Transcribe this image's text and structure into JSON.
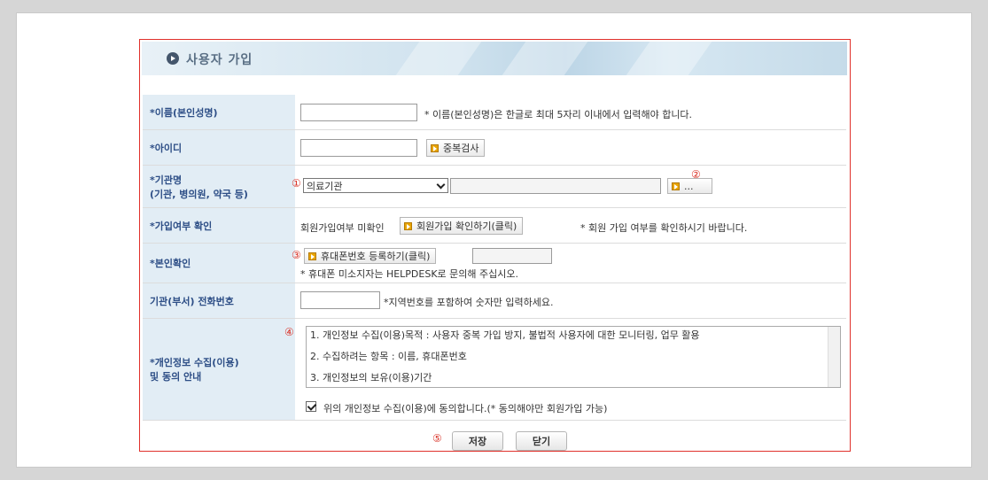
{
  "header": {
    "title": "사용자 가입"
  },
  "fields": {
    "name": {
      "label": "*이름(본인성명)",
      "value": "",
      "hint": "* 이름(본인성명)은 한글로 최대 5자리 이내에서 입력해야 합니다."
    },
    "id": {
      "label": "*아이디",
      "value": "",
      "check_button": "중복검사"
    },
    "org": {
      "label_line1": "*기관명",
      "label_line2": "(기관, 병의원, 약국 등)",
      "marker": "①",
      "select_value": "의료기관",
      "text_value": "",
      "search_button": "...",
      "marker2": "②"
    },
    "join_check": {
      "label": "*가입여부 확인",
      "status": "회원가입여부 미확인",
      "button": "회원가입 확인하기(클릭)",
      "hint": "* 회원 가입 여부를 확인하시기 바랍니다."
    },
    "identity": {
      "label": "*본인확인",
      "marker": "③",
      "button": "휴대폰번호 등록하기(클릭)",
      "value": "",
      "note": "* 휴대폰 미소지자는 HELPDESK로 문의해 주십시오."
    },
    "phone": {
      "label": "기관(부서) 전화번호",
      "value": "",
      "hint": "*지역번호를 포함하여 숫자만 입력하세요."
    },
    "privacy": {
      "label_line1": "*개인정보 수집(이용)",
      "label_line2": "및 동의 안내",
      "marker": "④",
      "lines": [
        "1. 개인정보 수집(이용)목적 : 사용자 중복 가입 방지, 불법적 사용자에 대한 모니터링, 업무 활용",
        "2. 수집하려는 항목 : 이름, 휴대폰번호",
        "3. 개인정보의 보유(이용)기간"
      ],
      "agree_label": "위의 개인정보 수집(이용)에 동의합니다.(* 동의해야만 회원가입 가능)",
      "agree_checked": true
    }
  },
  "footer": {
    "marker": "⑤",
    "save_label": "저장",
    "close_label": "닫기"
  },
  "colors": {
    "accent_red": "#e0312b",
    "label_bg": "#e2edf5",
    "label_text": "#2d4e86"
  }
}
